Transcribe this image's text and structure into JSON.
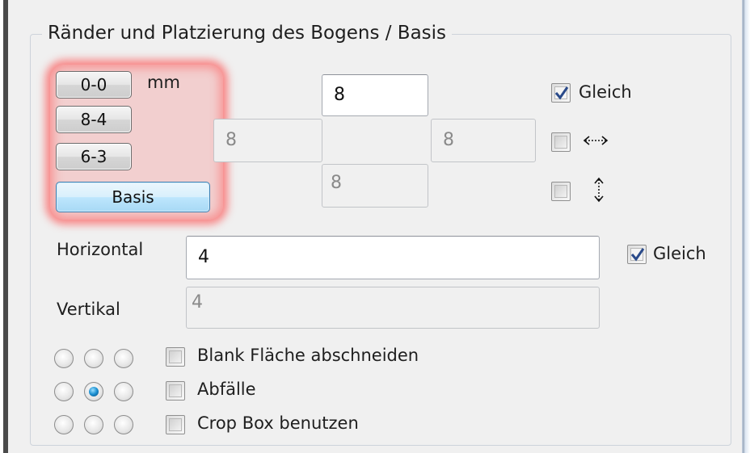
{
  "group": {
    "title": "Ränder und Platzierung des Bogens / Basis"
  },
  "presets": {
    "items": [
      "0-0",
      "8-4",
      "6-3",
      "Basis"
    ],
    "unit": "mm",
    "highlight_color": "#ff3c3c"
  },
  "margins": {
    "top": "8",
    "left": "8",
    "right": "8",
    "bottom": "8"
  },
  "margin_options": {
    "equal_label": "Gleich",
    "equal_checked": true,
    "mirror_horizontal_checked": false,
    "mirror_horizontal_icon": "horizontal-arrows-icon",
    "mirror_vertical_checked": false,
    "mirror_vertical_icon": "vertical-arrows-icon"
  },
  "spacing": {
    "horizontal_label": "Horizontal",
    "horizontal_value": "4",
    "vertical_label": "Vertikal",
    "vertical_value": "4",
    "equal_label": "Gleich",
    "equal_checked": true
  },
  "placement": {
    "selected_row": 1,
    "selected_col": 1
  },
  "options": [
    {
      "label": "Blank Fläche abschneiden",
      "checked": false
    },
    {
      "label": "Abfälle",
      "checked": false
    },
    {
      "label": "Crop Box benutzen",
      "checked": false
    }
  ],
  "colors": {
    "checkmark": "#2a4a8a",
    "radio_selected": "#1a8ed0",
    "active_button": "#a7d9f5"
  }
}
